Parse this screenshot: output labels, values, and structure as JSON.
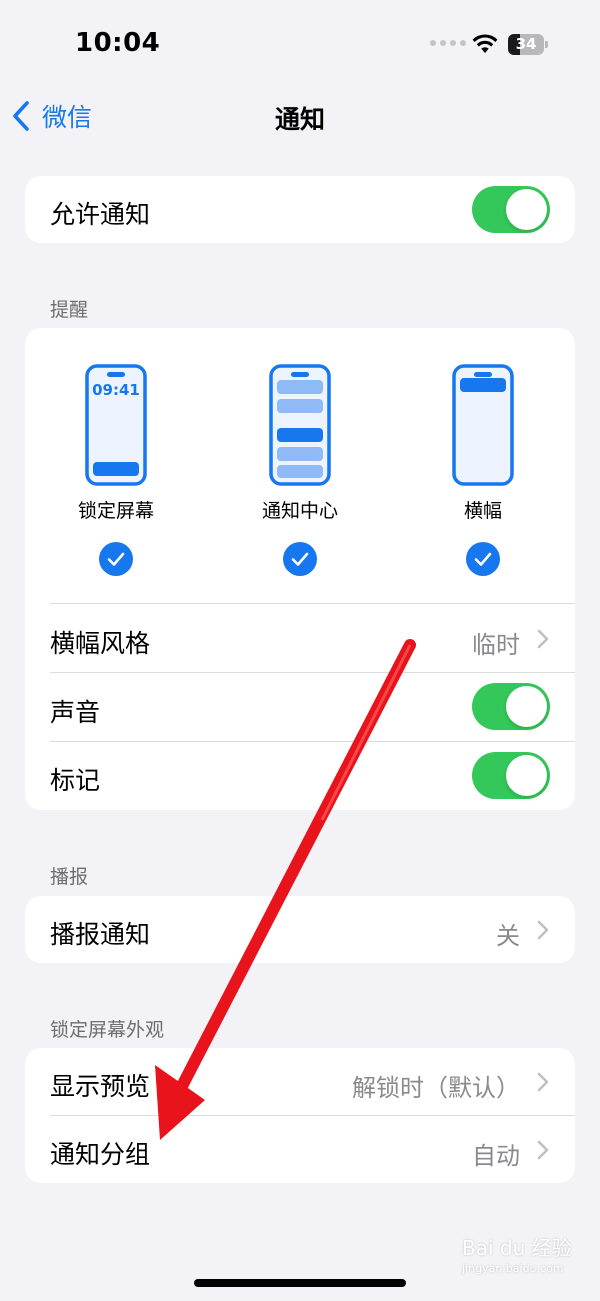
{
  "status_bar": {
    "time": "10:04",
    "battery": "34",
    "battery_level": 0.34
  },
  "nav": {
    "back_label": "微信",
    "title": "通知"
  },
  "allow": {
    "label": "允许通知",
    "enabled": true
  },
  "alerts": {
    "header": "提醒",
    "phone_clock": "09:41",
    "styles": [
      {
        "label": "锁定屏幕",
        "checked": true
      },
      {
        "label": "通知中心",
        "checked": true
      },
      {
        "label": "横幅",
        "checked": true
      }
    ],
    "banner_style": {
      "label": "横幅风格",
      "value": "临时"
    },
    "sounds": {
      "label": "声音",
      "enabled": true
    },
    "badges": {
      "label": "标记",
      "enabled": true
    }
  },
  "announce": {
    "header": "播报",
    "announce_notifications": {
      "label": "播报通知",
      "value": "关"
    }
  },
  "lock_screen": {
    "header": "锁定屏幕外观",
    "show_previews": {
      "label": "显示预览",
      "value": "解锁时（默认）"
    },
    "grouping": {
      "label": "通知分组",
      "value": "自动"
    }
  },
  "watermark": {
    "text": "Bai du 经验",
    "sub": "jingyan.baidu.com"
  },
  "colors": {
    "accent": "#1677ef",
    "toggle_on": "#34c759",
    "annotation_arrow": "#e8131b"
  }
}
